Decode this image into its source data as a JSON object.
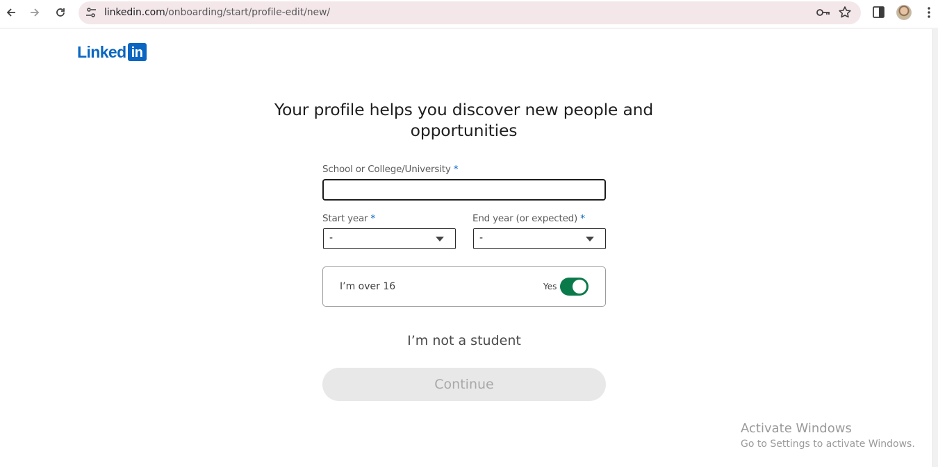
{
  "browser": {
    "url_host": "linkedin.com",
    "url_path": "/onboarding/start/profile-edit/new/",
    "icons": [
      "back-arrow-icon",
      "forward-arrow-icon",
      "reload-icon",
      "site-settings-icon",
      "password-key-icon",
      "bookmark-star-icon",
      "side-panel-icon",
      "profile-avatar",
      "kebab-menu-icon"
    ]
  },
  "logo": {
    "word": "Linked",
    "box": "in",
    "brand_color": "#0a66c2"
  },
  "form": {
    "headline_line1": "Your profile helps you discover new people and",
    "headline_line2": "opportunities",
    "school_label": "School or College/University",
    "school_value": "",
    "required_mark": "*",
    "start_year_label": "Start year",
    "start_year_value": "-",
    "end_year_label": "End year (or expected)",
    "end_year_value": "-",
    "age_label": "I’m over 16",
    "age_toggle_text": "Yes",
    "age_toggle_on": true,
    "toggle_color": "#0a7a4a",
    "not_student_link": "I’m not a student",
    "continue_label": "Continue",
    "continue_enabled": false
  },
  "watermark": {
    "title": "Activate Windows",
    "subtitle": "Go to Settings to activate Windows."
  }
}
